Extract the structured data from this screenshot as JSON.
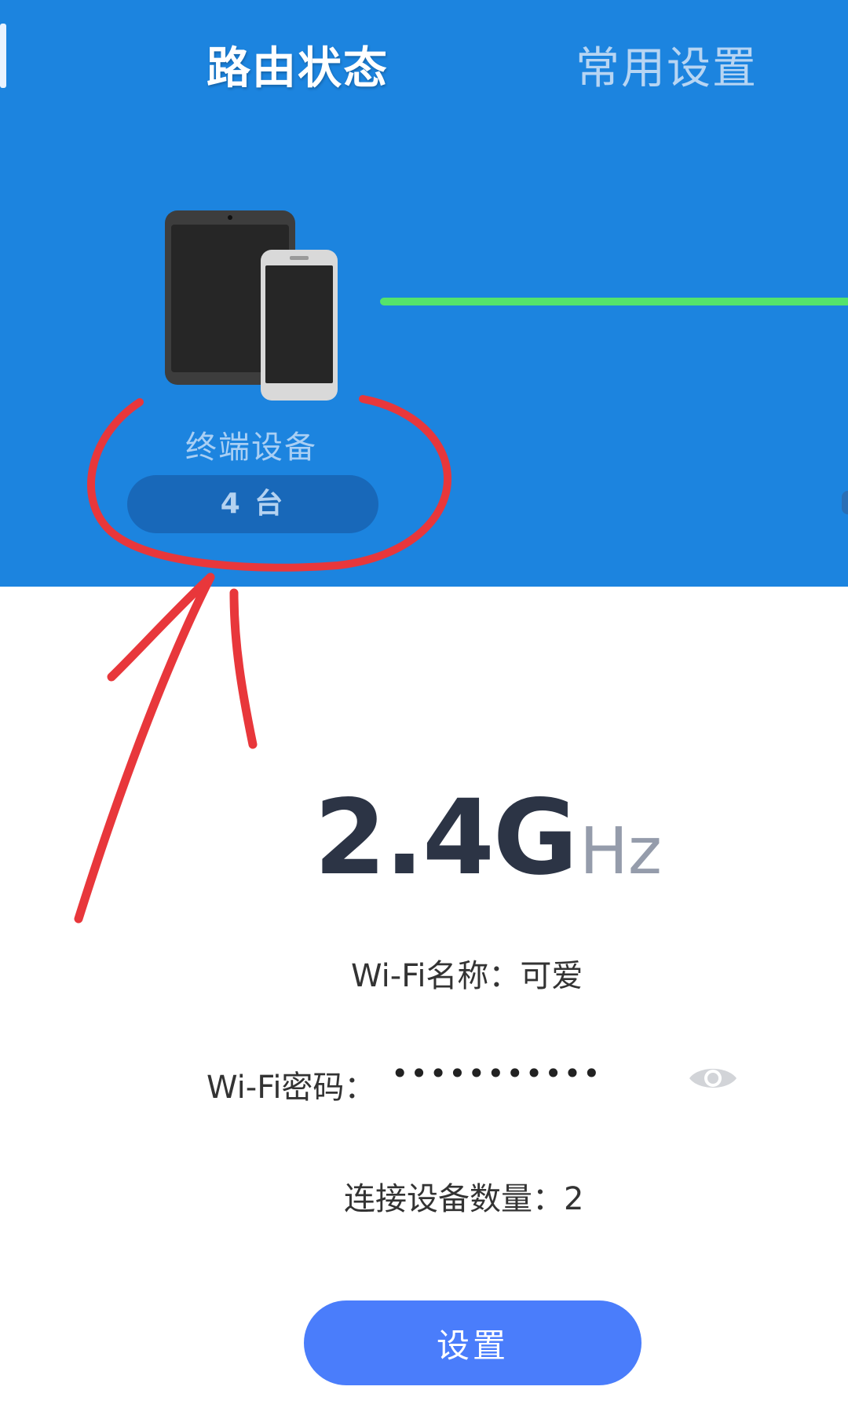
{
  "tabs": {
    "router_status": "路由状态",
    "common_settings": "常用设置"
  },
  "devices": {
    "label": "终端设备",
    "count": "4 台",
    "icon": "tablet-and-phone-icon"
  },
  "wifi": {
    "band": "2.4G",
    "band_unit": "Hz",
    "name_line": "Wi-Fi名称：可爱",
    "password_label": "Wi-Fi密码：",
    "password_masked": "•••••••••••",
    "connected_line": "连接设备数量：2"
  },
  "actions": {
    "settings_label": "设置"
  },
  "colors": {
    "header_blue": "#1c84df",
    "link_green": "#54e36c",
    "button_blue": "#4a7dfb",
    "annotation_red": "#e8373b"
  }
}
